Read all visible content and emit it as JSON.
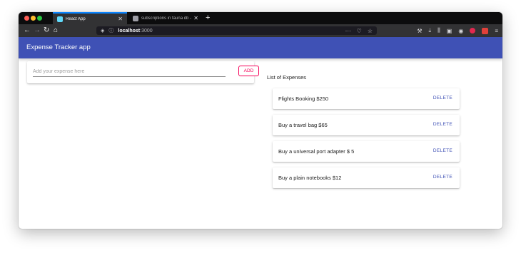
{
  "browser": {
    "tabs": [
      {
        "title": "React App",
        "active": true,
        "icon": "react-icon"
      },
      {
        "title": "subscriptions in fauna db - Go",
        "active": false,
        "icon": "globe-icon"
      }
    ],
    "url": {
      "host": "localhost",
      "port": ":3000"
    },
    "colors": {
      "tab_accent": "#0a84ff",
      "chrome": "#323234"
    }
  },
  "app": {
    "title": "Expense Tracker app",
    "header_color": "#3f51b5",
    "input": {
      "placeholder": "Add your expense here",
      "value": ""
    },
    "add_label": "ADD",
    "add_color": "#f50057",
    "list_title": "List of Expenses",
    "expenses": [
      {
        "text": "Flights Booking $250",
        "action": "DELETE"
      },
      {
        "text": "Buy a travel bag $65",
        "action": "DELETE"
      },
      {
        "text": "Buy a universal port adapter $ 5",
        "action": "DELETE"
      },
      {
        "text": "Buy a plain notebooks $12",
        "action": "DELETE"
      }
    ]
  }
}
